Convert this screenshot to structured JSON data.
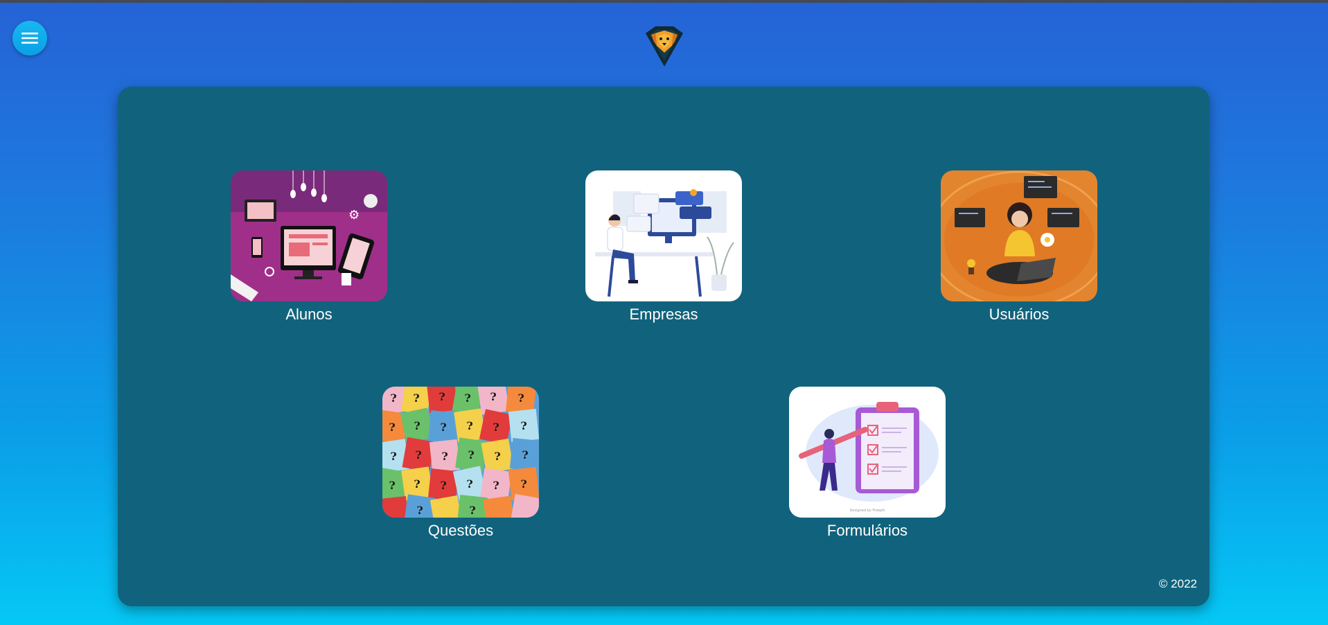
{
  "header": {
    "menu_icon": "hamburger-menu-icon",
    "logo_icon": "lion-shield-logo"
  },
  "cards": [
    {
      "label": "Alunos",
      "image": "devices-illustration"
    },
    {
      "label": "Empresas",
      "image": "office-worker-illustration"
    },
    {
      "label": "Usuários",
      "image": "developer-laptop-illustration"
    },
    {
      "label": "Questões",
      "image": "question-notes-photo"
    },
    {
      "label": "Formulários",
      "image": "checklist-clipboard-illustration"
    }
  ],
  "footer": {
    "copyright": "© 2022"
  },
  "colors": {
    "panel": "#11637d",
    "gradient_top": "#2563d6",
    "gradient_bottom": "#05c8f5"
  }
}
